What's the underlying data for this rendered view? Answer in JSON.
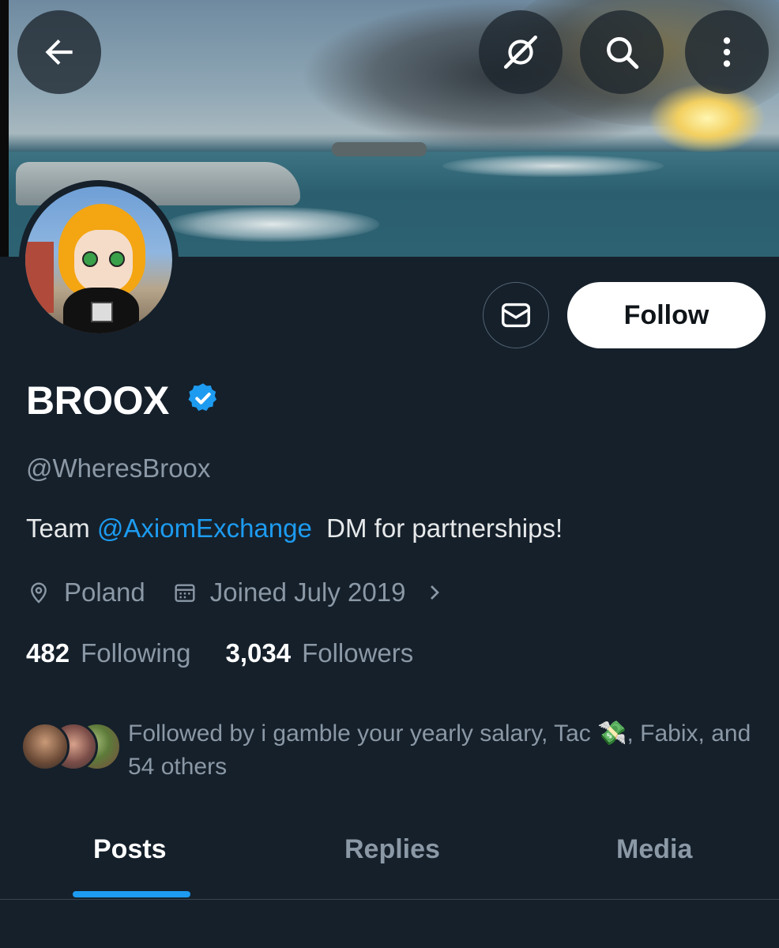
{
  "header": {
    "back_icon": "arrow-left-icon",
    "grok_icon": "grok-slash-icon",
    "search_icon": "search-icon",
    "more_icon": "more-vertical-icon"
  },
  "profile": {
    "display_name": "BROOX",
    "verified": true,
    "handle": "@WheresBroox",
    "bio_prefix": "Team ",
    "bio_mention": "@AxiomExchange",
    "bio_suffix": "  DM for partnerships!",
    "location": "Poland",
    "joined": "Joined July 2019",
    "following_count": "482",
    "following_label": "Following",
    "followers_count": "3,034",
    "followers_label": "Followers",
    "followed_by_text": "Followed by i gamble your yearly salary, Tac 💸, Fabix, and 54 others"
  },
  "actions": {
    "message_icon": "envelope-icon",
    "follow_label": "Follow"
  },
  "tabs": [
    {
      "label": "Posts",
      "active": true
    },
    {
      "label": "Replies",
      "active": false
    },
    {
      "label": "Media",
      "active": false
    }
  ],
  "colors": {
    "background": "#15202b",
    "accent": "#1d9bf0",
    "muted_text": "#8b98a5",
    "primary_text": "#e7e9ea"
  }
}
